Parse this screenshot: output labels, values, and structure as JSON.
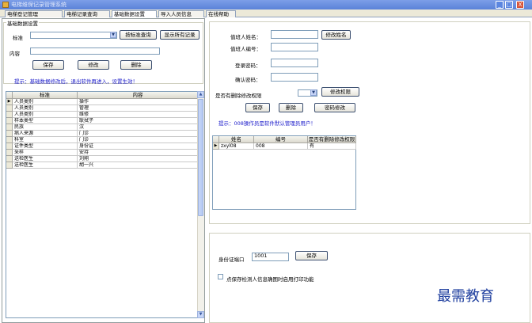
{
  "window": {
    "title": "电梯维保记录管理系统",
    "controls": {
      "minimize": "_",
      "maximize": "□",
      "close": "X"
    }
  },
  "tabs": [
    "电梯登记管理",
    "电梯记录查询",
    "基础数据设置",
    "导入人员信息",
    "在线帮助"
  ],
  "active_tab": 2,
  "base_data": {
    "legend": "基础数据设置",
    "category_label": "标准",
    "content_label": "内容",
    "category_value": "",
    "content_value": "",
    "query_button": "按标准查询",
    "show_all_button": "显示所有记录",
    "save_button": "保存",
    "edit_button": "修改",
    "delete_button": "删除",
    "hint": "提示：基础数据修改后，退出软件再进入，设置生效！"
  },
  "table": {
    "columns": [
      "标准",
      "内容"
    ],
    "rows": [
      [
        "人员类别",
        "操作"
      ],
      [
        "人员类别",
        "管理"
      ],
      [
        "人员类别",
        "维修"
      ],
      [
        "样本类型",
        "耿拭子"
      ],
      [
        "民族",
        "汉"
      ],
      [
        "病人来源",
        "门诊"
      ],
      [
        "科室",
        "门诊"
      ],
      [
        "证件类型",
        "身份证"
      ],
      [
        "采样",
        "安持"
      ],
      [
        "送检医生",
        "刘翔"
      ],
      [
        "送检医生",
        "胡一兴"
      ]
    ]
  },
  "operator": {
    "name_label": "值班人姓名：",
    "id_label": "值班人编号：",
    "password_label": "登录密码：",
    "confirm_label": "确认密码：",
    "permission_label": "是否有删除修改权限",
    "name_value": "",
    "id_value": "",
    "password_value": "",
    "confirm_value": "",
    "permission_value": "",
    "modify_name_button": "修改姓名",
    "modify_permission_button": "修改权限",
    "save_button": "保存",
    "delete_button": "删除",
    "change_password_button": "密码修改",
    "hint": "提示：008操作员是软件默认管理员用户！",
    "grid_columns": [
      "姓名",
      "编号",
      "是否有删除修改权限"
    ],
    "grid_rows": [
      [
        "zxyl08",
        "008",
        "有"
      ]
    ]
  },
  "id_card": {
    "port_label": "身份证端口",
    "port_value": "1001",
    "save_button": "保存",
    "checkbox_label": "点保存检测人信息确图时启用打印功能"
  },
  "watermark": "最需教育"
}
